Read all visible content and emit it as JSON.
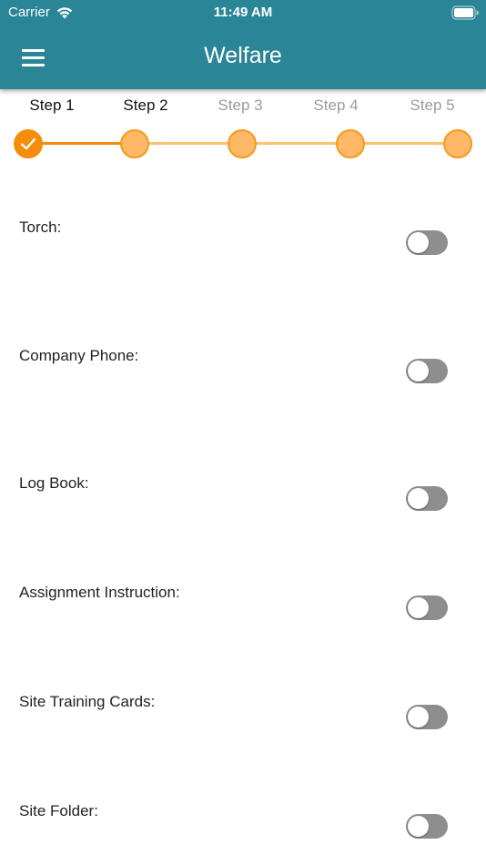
{
  "status_bar": {
    "carrier": "Carrier",
    "time": "11:49 AM"
  },
  "header": {
    "title": "Welfare",
    "menu_icon": "hamburger-menu-icon"
  },
  "stepper": {
    "steps": [
      {
        "label": "Step 1",
        "state": "completed"
      },
      {
        "label": "Step 2",
        "state": "current"
      },
      {
        "label": "Step 3",
        "state": "pending"
      },
      {
        "label": "Step 4",
        "state": "pending"
      },
      {
        "label": "Step 5",
        "state": "pending"
      }
    ],
    "colors": {
      "completed": "#f58d0b",
      "pending": "#ffb866",
      "line_done": "#f58d0b",
      "line_pending": "#ffc172"
    }
  },
  "fields": [
    {
      "label": "Torch:",
      "on": false
    },
    {
      "label": "Company Phone:",
      "on": false
    },
    {
      "label": "Log Book:",
      "on": false
    },
    {
      "label": "Assignment Instruction:",
      "on": false
    },
    {
      "label": "Site Training Cards:",
      "on": false
    },
    {
      "label": "Site Folder:",
      "on": false
    }
  ],
  "colors": {
    "header_bg": "#2a8596",
    "toggle_off": "#8e8e8e"
  }
}
